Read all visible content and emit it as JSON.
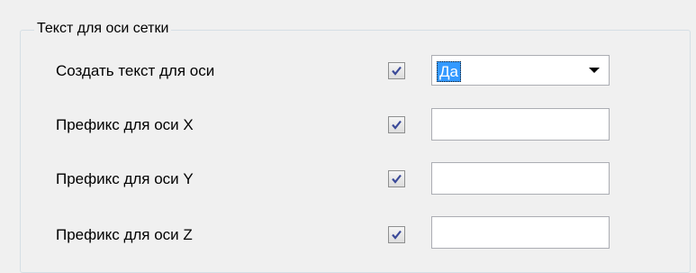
{
  "group": {
    "title": "Текст для оси сетки"
  },
  "rows": [
    {
      "label": "Создать текст для оси",
      "checked": true,
      "control": "dropdown",
      "value": "Да"
    },
    {
      "label": "Префикс для оси X",
      "checked": true,
      "control": "text",
      "value": ""
    },
    {
      "label": "Префикс для оси Y",
      "checked": true,
      "control": "text",
      "value": ""
    },
    {
      "label": "Префикс для оси Z",
      "checked": true,
      "control": "text",
      "value": ""
    }
  ],
  "icons": {
    "checkbox_mark": "checkmark-icon",
    "dropdown_arrow": "chevron-down-icon"
  },
  "colors": {
    "selection": "#3399ff",
    "checkmark": "#3b4a99",
    "group_border": "#d5dfe5"
  }
}
